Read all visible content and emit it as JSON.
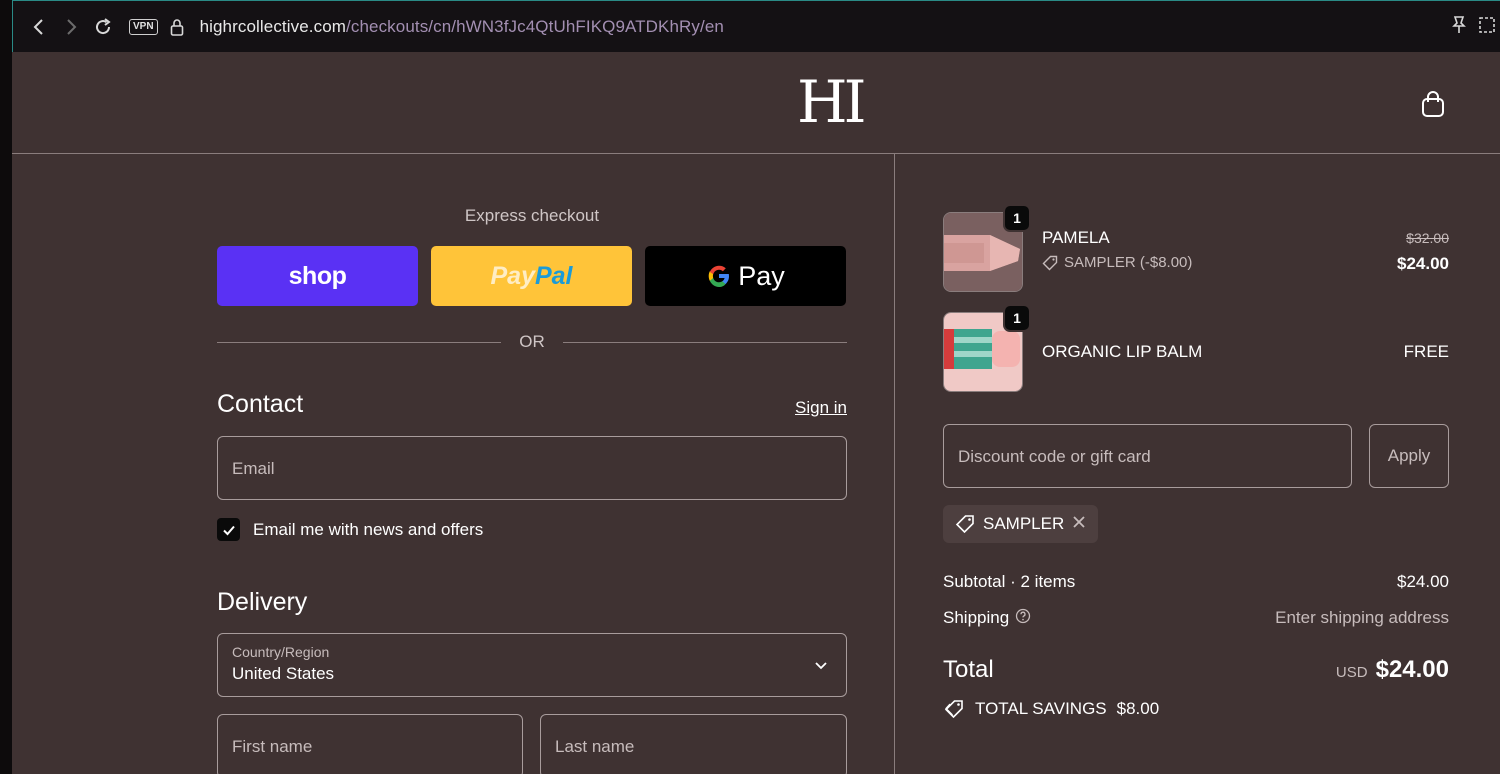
{
  "browser": {
    "url_host": "highrcollective.com",
    "url_path": "/checkouts/cn/hWN3fJc4QtUhFIKQ9ATDKhRy/en",
    "vpn_label": "VPN"
  },
  "header": {
    "logo_text": "HI"
  },
  "express": {
    "title": "Express checkout",
    "shop_label": "shop",
    "paypal_a": "Pay",
    "paypal_b": "Pal",
    "gpay_label": "Pay",
    "or_label": "OR"
  },
  "contact": {
    "title": "Contact",
    "signin_label": "Sign in",
    "email_placeholder": "Email",
    "news_label": "Email me with news and offers",
    "news_checked": true
  },
  "delivery": {
    "title": "Delivery",
    "country_label": "Country/Region",
    "country_value": "United States",
    "first_name_placeholder": "First name",
    "last_name_placeholder": "Last name"
  },
  "cart": {
    "items": [
      {
        "name": "PAMELA",
        "quantity": "1",
        "discount_label": "SAMPLER (-$8.00)",
        "original_price": "$32.00",
        "price": "$24.00"
      },
      {
        "name": "ORGANIC LIP BALM",
        "quantity": "1",
        "price": "FREE"
      }
    ],
    "discount_placeholder": "Discount code or gift card",
    "apply_label": "Apply",
    "applied_code": "SAMPLER"
  },
  "summary": {
    "subtotal_label": "Subtotal · 2 items",
    "subtotal_value": "$24.00",
    "shipping_label": "Shipping",
    "shipping_value": "Enter shipping address",
    "total_label": "Total",
    "currency": "USD",
    "total_value": "$24.00",
    "savings_label": "TOTAL SAVINGS",
    "savings_value": "$8.00"
  },
  "colors": {
    "page_bg": "#3f3232",
    "shop_purple": "#5a31f4",
    "paypal_yellow": "#ffc439",
    "gpay_black": "#000000"
  }
}
